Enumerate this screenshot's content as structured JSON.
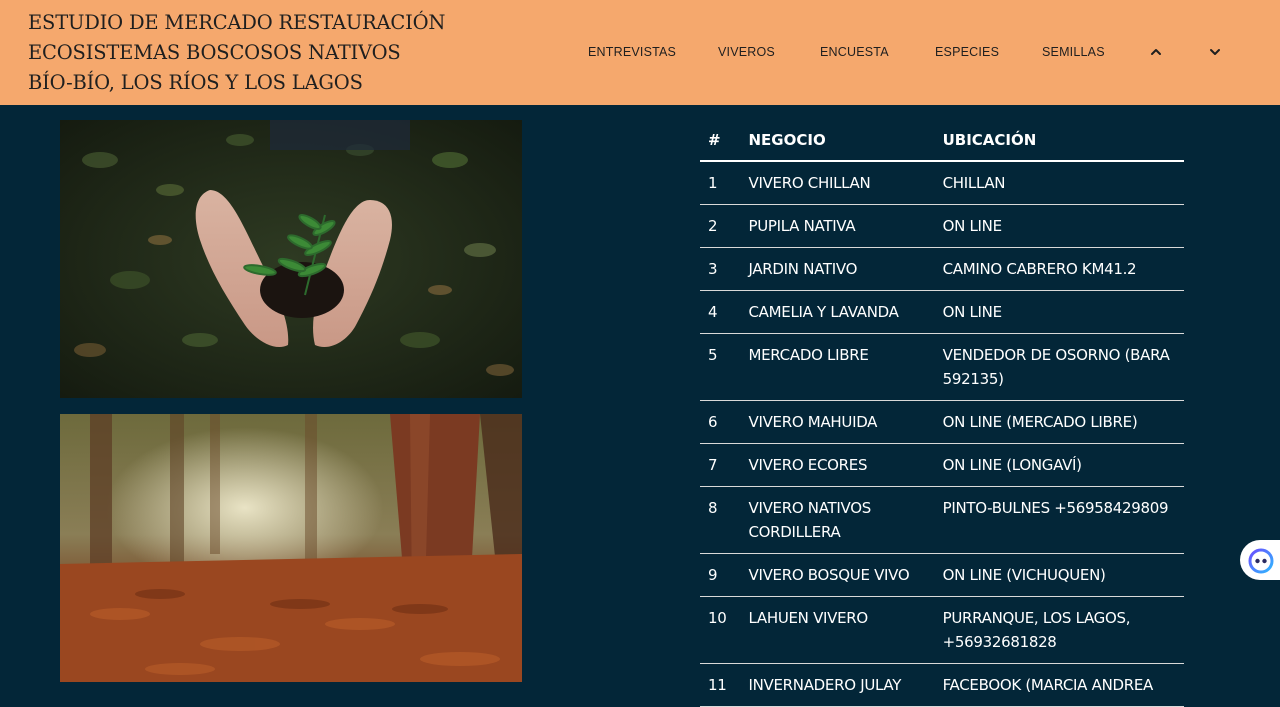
{
  "header": {
    "title_lines": [
      "ESTUDIO DE MERCADO RESTAURACIÓN",
      "ECOSISTEMAS BOSCOSOS NATIVOS",
      "BÍO-BÍO, LOS RÍOS Y LOS LAGOS"
    ],
    "nav": [
      {
        "label": "ENTREVISTAS"
      },
      {
        "label": "VIVEROS"
      },
      {
        "label": "ENCUESTA"
      },
      {
        "label": "ESPECIES"
      },
      {
        "label": "SEMILLAS"
      }
    ],
    "chevron_up_icon": "chevron-up-icon",
    "chevron_down_icon": "chevron-down-icon"
  },
  "images": [
    {
      "icon": "hands-holding-seedling-photo"
    },
    {
      "icon": "forest-path-autumn-leaves-photo"
    }
  ],
  "table": {
    "headers": [
      "#",
      "NEGOCIO",
      "UBICACIÓN"
    ],
    "rows": [
      {
        "num": "1",
        "negocio": "VIVERO CHILLAN",
        "ubicacion": "CHILLAN"
      },
      {
        "num": "2",
        "negocio": "PUPILA NATIVA",
        "ubicacion": "ON LINE"
      },
      {
        "num": "3",
        "negocio": "JARDIN NATIVO",
        "ubicacion": "CAMINO CABRERO KM41.2"
      },
      {
        "num": "4",
        "negocio": "CAMELIA Y LAVANDA",
        "ubicacion": "ON LINE"
      },
      {
        "num": "5",
        "negocio": "MERCADO LIBRE",
        "ubicacion": "VENDEDOR DE OSORNO (BARA 592135)"
      },
      {
        "num": "6",
        "negocio": "VIVERO MAHUIDA",
        "ubicacion": "ON LINE (MERCADO LIBRE)"
      },
      {
        "num": "7",
        "negocio": "VIVERO ECORES",
        "ubicacion": "ON LINE (LONGAVÍ)"
      },
      {
        "num": "8",
        "negocio": "VIVERO NATIVOS CORDILLERA",
        "ubicacion": "PINTO-BULNES +56958429809"
      },
      {
        "num": "9",
        "negocio": "VIVERO BOSQUE VIVO",
        "ubicacion": "ON LINE (VICHUQUEN)"
      },
      {
        "num": "10",
        "negocio": "LAHUEN VIVERO",
        "ubicacion": "PURRANQUE, LOS LAGOS, +56932681828"
      },
      {
        "num": "11",
        "negocio": "INVERNADERO JULAY",
        "ubicacion": "FACEBOOK (MARCIA ANDREA"
      }
    ]
  },
  "chat_widget": {
    "icon": "chat-assistant-icon"
  },
  "colors": {
    "header_bg": "#f5a86d",
    "page_bg": "#032638",
    "text_light": "#ffffff",
    "text_dark": "#1f1f1f"
  }
}
